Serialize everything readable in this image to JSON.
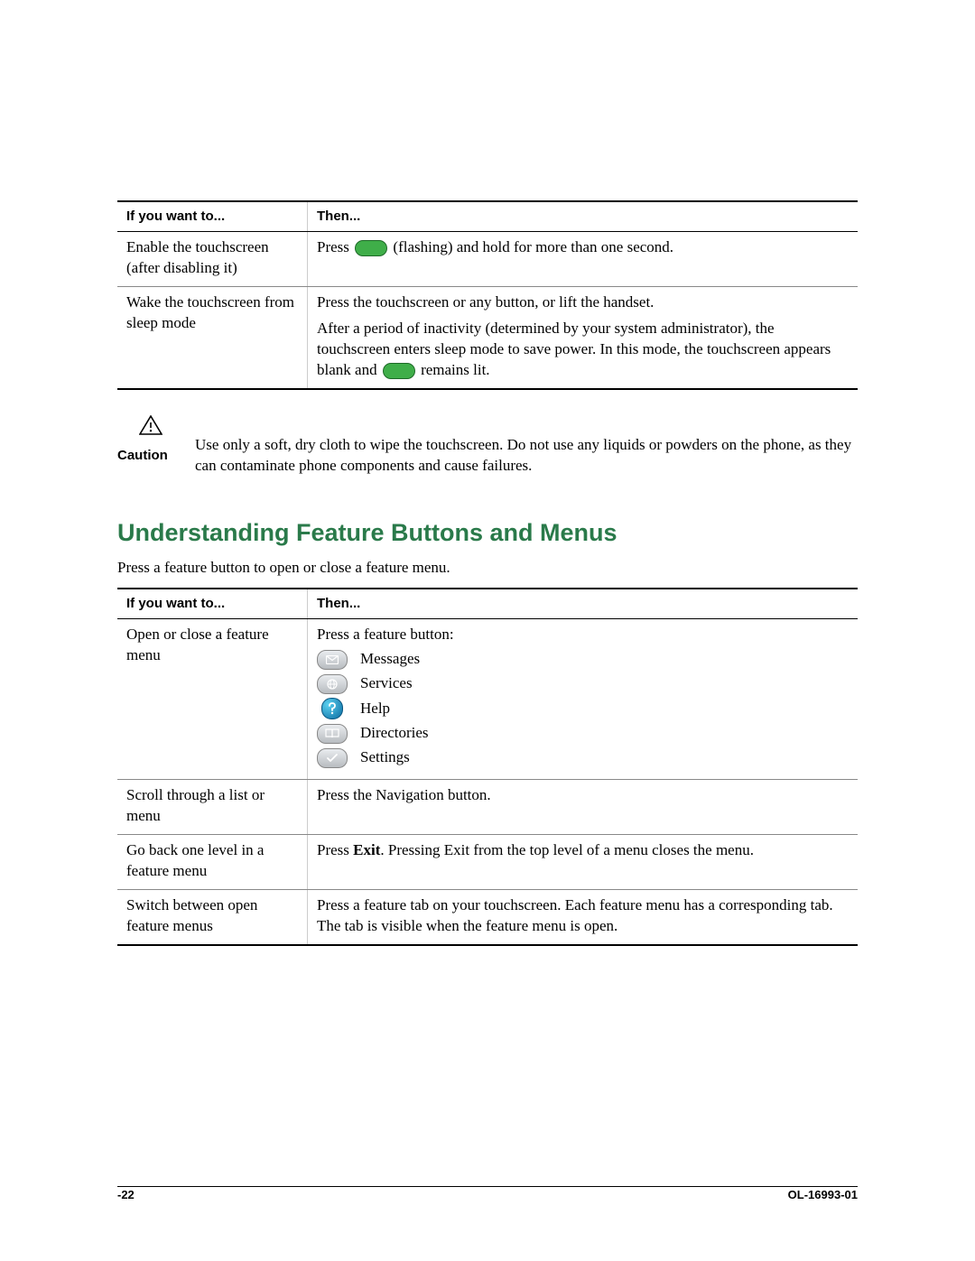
{
  "table1": {
    "headers": {
      "c1": "If you want to...",
      "c2": "Then..."
    },
    "rows": [
      {
        "c1": "Enable the touchscreen (after disabling it)",
        "c2_pre": "Press ",
        "c2_post": " (flashing) and hold for more than one second."
      },
      {
        "c1": "Wake the touchscreen from sleep mode",
        "c2_line1": "Press the touchscreen or any button, or lift the handset.",
        "c2_line2_pre": "After a period of inactivity (determined by your system administrator), the touchscreen enters sleep mode to save power. In this mode, the touchscreen appears blank and ",
        "c2_line2_post": " remains lit."
      }
    ]
  },
  "caution": {
    "label": "Caution",
    "text": "Use only a soft, dry cloth to wipe the touchscreen. Do not use any liquids or powders on the phone, as they can contaminate phone components and cause failures."
  },
  "section_heading": "Understanding Feature Buttons and Menus",
  "section_intro": "Press a feature button to open or close a feature menu.",
  "table2": {
    "headers": {
      "c1": "If you want to...",
      "c2": "Then..."
    },
    "rows": [
      {
        "c1": "Open or close a feature menu",
        "c2_intro": "Press a feature button:",
        "items": [
          {
            "icon": "messages-icon",
            "label": "Messages"
          },
          {
            "icon": "services-icon",
            "label": "Services"
          },
          {
            "icon": "help-icon",
            "label": "Help"
          },
          {
            "icon": "directories-icon",
            "label": "Directories"
          },
          {
            "icon": "settings-icon",
            "label": "Settings"
          }
        ]
      },
      {
        "c1": "Scroll through a list or menu",
        "c2": "Press the Navigation button."
      },
      {
        "c1": "Go back one level in a feature menu",
        "c2_pre": "Press ",
        "c2_bold": "Exit",
        "c2_post": ". Pressing Exit from the top level of a menu closes the menu."
      },
      {
        "c1": "Switch between open feature menus",
        "c2": "Press a feature tab on your touchscreen. Each feature menu has a corresponding tab. The tab is visible when the feature menu is open."
      }
    ]
  },
  "footer": {
    "left": "-22",
    "right": "OL-16993-01"
  }
}
